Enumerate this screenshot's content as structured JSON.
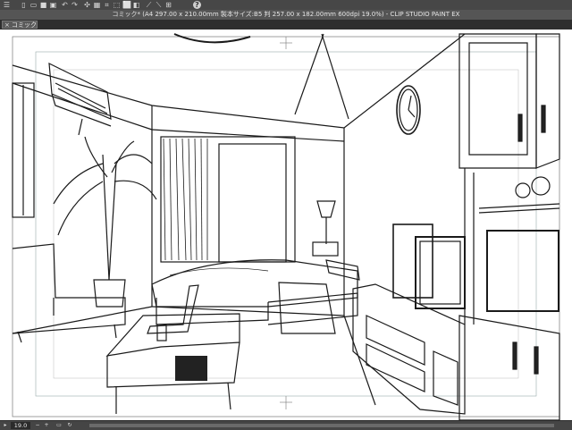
{
  "app": {
    "title": "コミック* (A4 297.00 x 210.00mm 製本サイズ:B5 判 257.00 x 182.00mm 600dpi 19.0%) - CLIP STUDIO PAINT EX"
  },
  "toolbar": {
    "icons": [
      "menu-icon",
      "new-file-icon",
      "open-file-icon",
      "save-icon",
      "save-as-icon",
      "undo-icon",
      "redo-icon",
      "transform-icon",
      "clear-icon",
      "crop-icon",
      "select-all-icon",
      "deselect-icon",
      "invert-icon",
      "snap-icon",
      "ruler-snap-icon",
      "grid-snap-icon",
      "help-icon"
    ]
  },
  "tab": {
    "label": "コミック*",
    "close": "×"
  },
  "status": {
    "zoom": "19.0"
  }
}
